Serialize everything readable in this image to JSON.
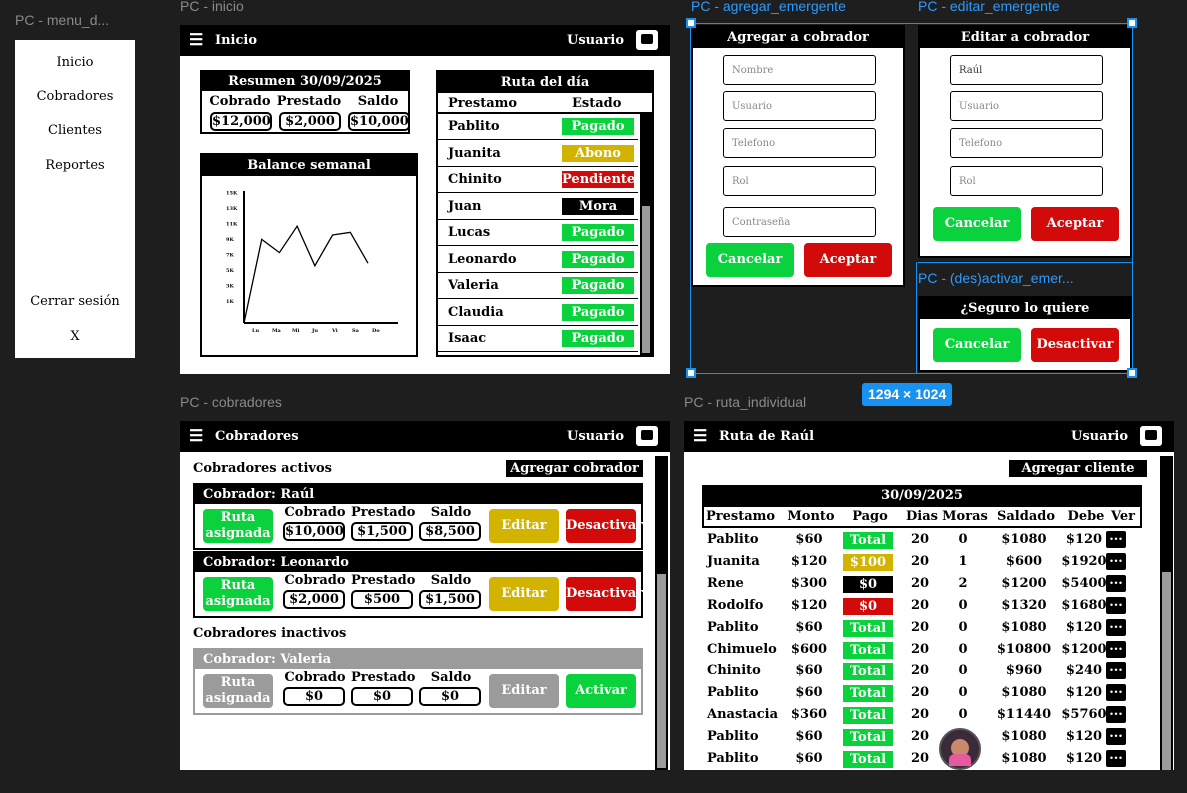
{
  "labels": {
    "menu": "PC - menu_d...",
    "inicio": "PC - inicio",
    "agregar": "PC - agregar_emergente",
    "editar": "PC - editar_emergente",
    "desactivar": "PC - (des)activar_emer...",
    "cobradores": "PC - cobradores",
    "ruta": "PC - ruta_individual",
    "size_badge": "1294 × 1024"
  },
  "menu": {
    "items": [
      "Inicio",
      "Cobradores",
      "Clientes",
      "Reportes"
    ],
    "logout": "Cerrar sesión",
    "close": "X"
  },
  "inicio": {
    "title": "Inicio",
    "user": "Usuario",
    "summary": {
      "title": "Resumen 30/09/2025",
      "headers": [
        "Cobrado",
        "Prestado",
        "Saldo"
      ],
      "values": [
        "$12,000",
        "$2,000",
        "$10,000"
      ]
    },
    "balance_title": "Balance semanal",
    "route": {
      "title": "Ruta del día",
      "col1": "Prestamo",
      "col2": "Estado",
      "rows": [
        {
          "name": "Pablito",
          "status": "Pagado",
          "color": "#0ad23c"
        },
        {
          "name": "Juanita",
          "status": "Abono",
          "color": "#d2b400"
        },
        {
          "name": "Chinito",
          "status": "Pendiente",
          "color": "#d20a0a"
        },
        {
          "name": "Juan",
          "status": "Mora",
          "color": "#000000"
        },
        {
          "name": "Lucas",
          "status": "Pagado",
          "color": "#0ad23c"
        },
        {
          "name": "Leonardo",
          "status": "Pagado",
          "color": "#0ad23c"
        },
        {
          "name": "Valeria",
          "status": "Pagado",
          "color": "#0ad23c"
        },
        {
          "name": "Claudia",
          "status": "Pagado",
          "color": "#0ad23c"
        },
        {
          "name": "Isaac",
          "status": "Pagado",
          "color": "#0ad23c"
        }
      ]
    }
  },
  "chart_data": {
    "type": "line",
    "categories": [
      "Lu",
      "Ma",
      "Mi",
      "Ju",
      "Vi",
      "Sa",
      "Do"
    ],
    "ytick_labels": [
      "1K",
      "3K",
      "5K",
      "7K",
      "9K",
      "11K",
      "13K",
      "15K"
    ],
    "values": [
      0,
      9.5,
      8,
      11,
      6.5,
      10,
      10.3,
      6.8
    ],
    "ylim": [
      0,
      15
    ]
  },
  "agregar": {
    "title": "Agregar a cobrador",
    "fields": [
      "Nombre",
      "Usuario",
      "Telefono",
      "Rol",
      "Contraseña"
    ],
    "cancel": "Cancelar",
    "accept": "Aceptar"
  },
  "editar": {
    "title": "Editar a cobrador",
    "fields": [
      "Raúl",
      "Usuario",
      "Telefono",
      "Rol"
    ],
    "cancel": "Cancelar",
    "accept": "Aceptar"
  },
  "desactivar": {
    "question": "¿Seguro lo quiere (des)activar?",
    "cancel": "Cancelar",
    "confirm": "Desactivar"
  },
  "cobradores": {
    "title": "Cobradores",
    "user": "Usuario",
    "active_label": "Cobradores activos",
    "add_button": "Agregar cobrador",
    "inactive_label": "Cobradores inactivos",
    "headers": [
      "Cobrado",
      "Prestado",
      "Saldo"
    ],
    "route_button": "Ruta asignada",
    "edit": "Editar",
    "deactivate": "Desactivar",
    "activate": "Activar",
    "active": [
      {
        "name": "Cobrador: Raúl",
        "values": [
          "$10,000",
          "$1,500",
          "$8,500"
        ]
      },
      {
        "name": "Cobrador: Leonardo",
        "values": [
          "$2,000",
          "$500",
          "$1,500"
        ]
      }
    ],
    "inactive": [
      {
        "name": "Cobrador: Valeria",
        "values": [
          "$0",
          "$0",
          "$0"
        ]
      }
    ]
  },
  "ruta": {
    "title": "Ruta de Raúl",
    "user": "Usuario",
    "add_client": "Agregar cliente",
    "date": "30/09/2025",
    "headers": [
      "Prestamo",
      "Monto",
      "Pago",
      "Dias",
      "Moras",
      "Saldado",
      "Debe",
      "Ver"
    ],
    "view_button": "...",
    "rows": [
      {
        "name": "Pablito",
        "monto": "$60",
        "pago": "Total",
        "pago_color": "#0ad23c",
        "dias": "20",
        "moras": "0",
        "saldado": "$1080",
        "debe": "$120"
      },
      {
        "name": "Juanita",
        "monto": "$120",
        "pago": "$100",
        "pago_color": "#d2b400",
        "dias": "20",
        "moras": "1",
        "saldado": "$600",
        "debe": "$1920"
      },
      {
        "name": "Rene",
        "monto": "$300",
        "pago": "$0",
        "pago_color": "#000000",
        "dias": "20",
        "moras": "2",
        "saldado": "$1200",
        "debe": "$5400"
      },
      {
        "name": "Rodolfo",
        "monto": "$120",
        "pago": "$0",
        "pago_color": "#d20a0a",
        "dias": "20",
        "moras": "0",
        "saldado": "$1320",
        "debe": "$1680"
      },
      {
        "name": "Pablito",
        "monto": "$60",
        "pago": "Total",
        "pago_color": "#0ad23c",
        "dias": "20",
        "moras": "0",
        "saldado": "$1080",
        "debe": "$120"
      },
      {
        "name": "Chimuelo",
        "monto": "$600",
        "pago": "Total",
        "pago_color": "#0ad23c",
        "dias": "20",
        "moras": "0",
        "saldado": "$10800",
        "debe": "$1200"
      },
      {
        "name": "Chinito",
        "monto": "$60",
        "pago": "Total",
        "pago_color": "#0ad23c",
        "dias": "20",
        "moras": "0",
        "saldado": "$960",
        "debe": "$240"
      },
      {
        "name": "Pablito",
        "monto": "$60",
        "pago": "Total",
        "pago_color": "#0ad23c",
        "dias": "20",
        "moras": "0",
        "saldado": "$1080",
        "debe": "$120"
      },
      {
        "name": "Anastacia",
        "monto": "$360",
        "pago": "Total",
        "pago_color": "#0ad23c",
        "dias": "20",
        "moras": "0",
        "saldado": "$11440",
        "debe": "$5760"
      },
      {
        "name": "Pablito",
        "monto": "$60",
        "pago": "Total",
        "pago_color": "#0ad23c",
        "dias": "20",
        "moras": "",
        "saldado": "$1080",
        "debe": "$120"
      },
      {
        "name": "Pablito",
        "monto": "$60",
        "pago": "Total",
        "pago_color": "#0ad23c",
        "dias": "20",
        "moras": "",
        "saldado": "$1080",
        "debe": "$120"
      }
    ]
  }
}
